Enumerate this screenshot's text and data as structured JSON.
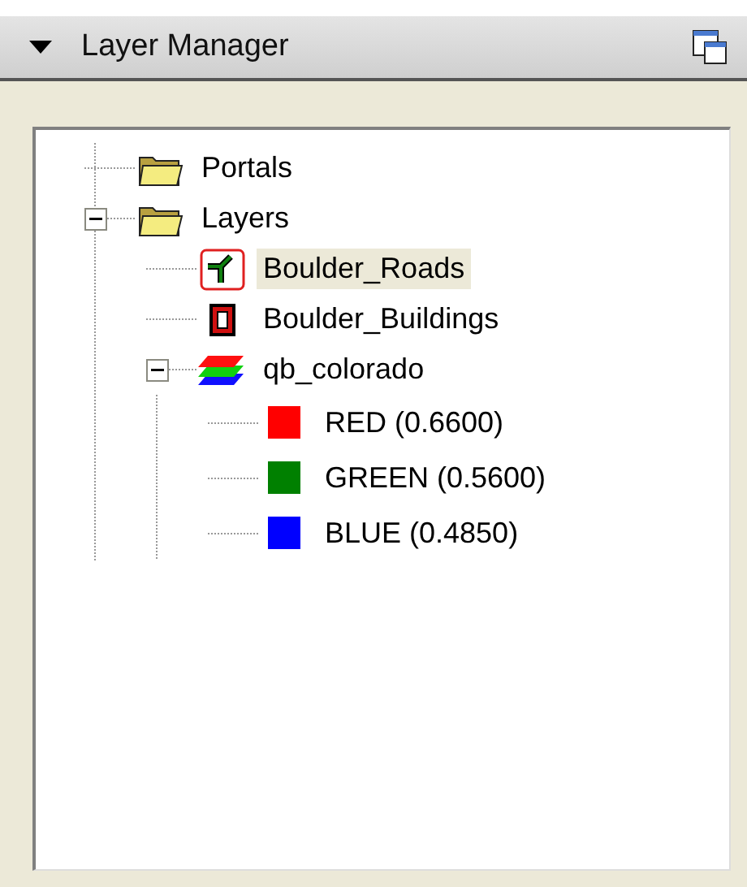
{
  "panel": {
    "title": "Layer Manager",
    "collapsed": false
  },
  "tree": [
    {
      "label": "Portals",
      "kind": "folder",
      "selected": false
    },
    {
      "label": "Layers",
      "kind": "folder",
      "selected": false,
      "expanded": true,
      "children": [
        {
          "label": "Boulder_Roads",
          "kind": "lines",
          "selected": true
        },
        {
          "label": "Boulder_Buildings",
          "kind": "polygons",
          "selected": false
        },
        {
          "label": "qb_colorado",
          "kind": "raster",
          "selected": false,
          "expanded": true,
          "children": [
            {
              "label": "RED (0.6600)",
              "kind": "band",
              "color": "#ff0000",
              "selected": false
            },
            {
              "label": "GREEN (0.5600)",
              "kind": "band",
              "color": "#008000",
              "selected": false
            },
            {
              "label": "BLUE (0.4850)",
              "kind": "band",
              "color": "#0000ff",
              "selected": false
            }
          ]
        }
      ]
    }
  ]
}
